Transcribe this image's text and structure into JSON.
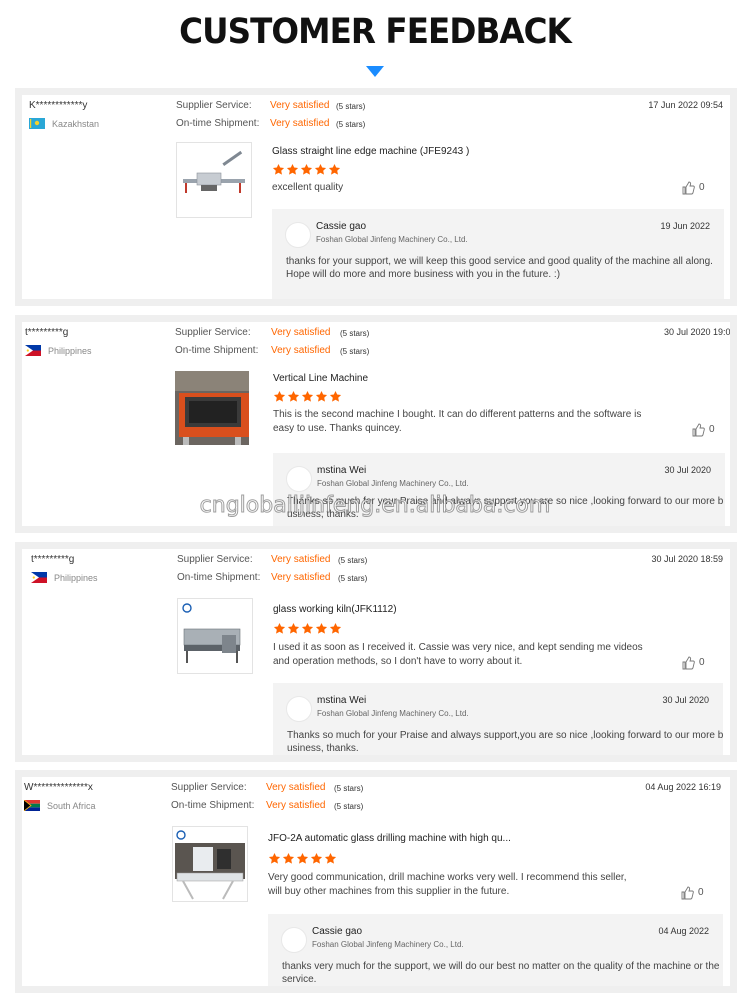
{
  "header": {
    "title": "CUSTOMER FEEDBACK"
  },
  "labels": {
    "supplier_service": "Supplier Service:",
    "ontime_shipment": "On-time Shipment:"
  },
  "watermark": "cngloballjinfeng.en.alibaba.com",
  "colors": {
    "accent_orange": "#ff6600",
    "arrow_blue": "#1a8cff",
    "star": "#ff6600"
  },
  "reviews": [
    {
      "user": "K************y",
      "country": "Kazakhstan",
      "supplier_rating": "Very satisfied",
      "supplier_stars": "(5 stars)",
      "shipment_rating": "Very satisfied",
      "shipment_stars": "(5 stars)",
      "date": "17 Jun 2022 09:54",
      "product": "Glass straight line edge machine (JFE9243 )",
      "rating": 5,
      "comment": "excellent quality",
      "likes": "0",
      "reply": {
        "name": "Cassie gao",
        "company": "Foshan Global Jinfeng Machinery Co., Ltd.",
        "date": "19 Jun 2022",
        "text": "thanks for your support, we will keep this good service and good quality of the machine all along.",
        "text2": "Hope will do more and more business with you in the future. :)"
      }
    },
    {
      "user": "t*********g",
      "country": "Philippines",
      "supplier_rating": "Very satisfied",
      "supplier_stars": "(5 stars)",
      "shipment_rating": "Very satisfied",
      "shipment_stars": "(5 stars)",
      "date": "30 Jul 2020 19:0",
      "product": "Vertical Line Machine",
      "rating": 5,
      "comment": "This is the second machine I bought. It can do different patterns and the software is easy to use. Thanks quincey.",
      "likes": "0",
      "reply": {
        "name": "mstina Wei",
        "company": "Foshan Global Jinfeng Machinery Co., Ltd.",
        "date": "30 Jul 2020",
        "text": "Thanks so much for your Praise and always support,you are so nice ,looking forward to our more business, thanks.",
        "text2": ""
      }
    },
    {
      "user": "t*********g",
      "country": "Philippines",
      "supplier_rating": "Very satisfied",
      "supplier_stars": "(5 stars)",
      "shipment_rating": "Very satisfied",
      "shipment_stars": "(5 stars)",
      "date": "30 Jul 2020 18:59",
      "product": "glass working kiln(JFK1112)",
      "rating": 5,
      "comment": "I used it as soon as I received it. Cassie was very nice, and kept sending me videos and operation methods, so I don't have to worry about it.",
      "likes": "0",
      "reply": {
        "name": "mstina Wei",
        "company": "Foshan Global Jinfeng Machinery Co., Ltd.",
        "date": "30 Jul 2020",
        "text": "Thanks so much for your Praise and always support,you are so nice ,looking forward to our more business, thanks.",
        "text2": ""
      }
    },
    {
      "user": "W**************x",
      "country": "South Africa",
      "supplier_rating": "Very satisfied",
      "supplier_stars": "(5 stars)",
      "shipment_rating": "Very satisfied",
      "shipment_stars": "(5 stars)",
      "date": "04 Aug 2022 16:19",
      "product": "JFO-2A automatic glass drilling machine with high qu...",
      "rating": 5,
      "comment": "Very good communication, drill machine works very well. I recommend this seller, will buy other machines from this supplier in the future.",
      "likes": "0",
      "reply": {
        "name": "Cassie gao",
        "company": "Foshan Global Jinfeng Machinery Co., Ltd.",
        "date": "04 Aug 2022",
        "text": "thanks very much for the support, we will do our best no matter on the quality of the machine or the service.",
        "text2": ""
      }
    }
  ]
}
